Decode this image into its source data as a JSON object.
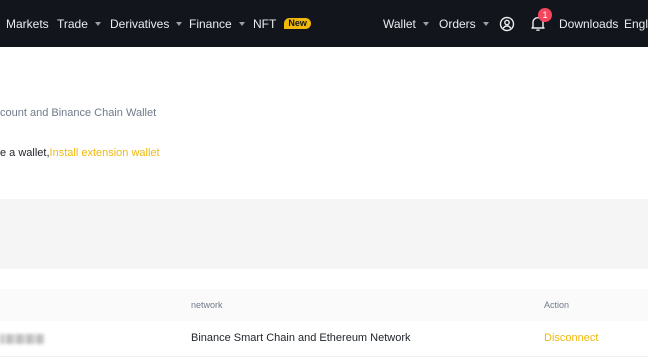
{
  "topbar": {
    "nav": {
      "markets": "Markets",
      "trade": "Trade",
      "derivatives": "Derivatives",
      "finance": "Finance",
      "nft": "NFT",
      "nft_badge": "New"
    },
    "right": {
      "wallet": "Wallet",
      "orders": "Orders",
      "notification_count": "1",
      "downloads": "Downloads",
      "language": "Engli"
    },
    "icons": [
      "chevron-down-icon",
      "user-icon",
      "bell-icon"
    ],
    "colors": {
      "background": "#12161c",
      "accent": "#f0b90b",
      "badge": "#f6465d"
    }
  },
  "main": {
    "description": "count and Binance Chain Wallet",
    "wallet_prompt": "e a wallet,",
    "install_link": "Install extension wallet"
  },
  "table": {
    "headers": {
      "network": "network",
      "action": "Action"
    },
    "rows": [
      {
        "network": "Binance Smart Chain and Ethereum Network",
        "action": "Disconnect"
      }
    ]
  }
}
